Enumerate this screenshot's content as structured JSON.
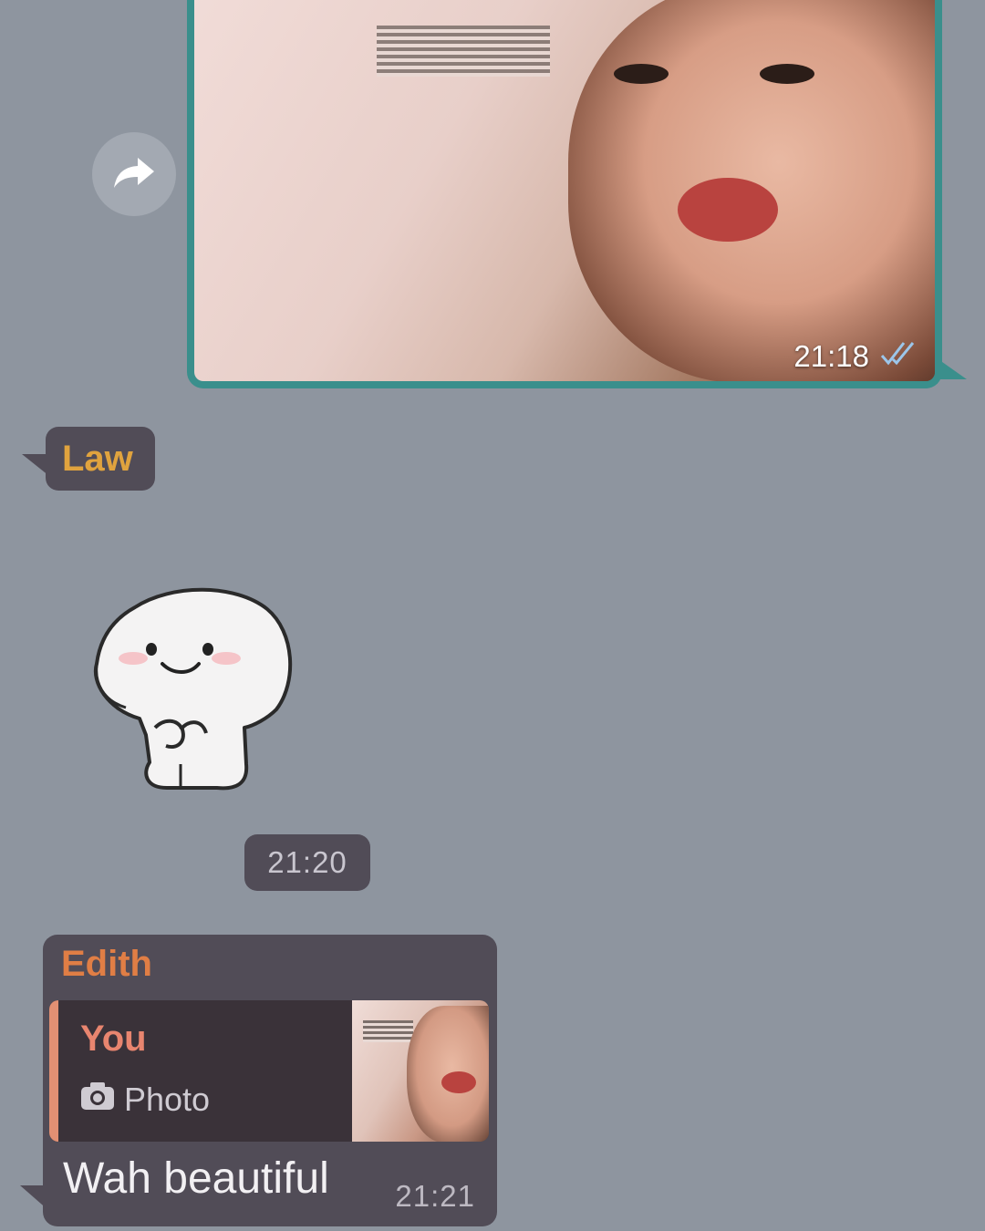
{
  "outgoing_photo": {
    "time": "21:18",
    "status_icon": "double-check-icon",
    "border_color": "#3a8f8c"
  },
  "forward": {
    "icon": "forward-arrow-icon"
  },
  "incoming_sender": {
    "name": "Law",
    "name_color": "#e0a33e"
  },
  "sticker": {
    "description_icon": "smiling-blob-sticker"
  },
  "time_chip": {
    "time": "21:20"
  },
  "reply_message": {
    "sender": "Edith",
    "sender_color": "#e07e45",
    "quoted": {
      "author": "You",
      "type_label": "Photo",
      "type_icon": "camera-icon"
    },
    "text": "Wah beautiful",
    "time": "21:21"
  }
}
